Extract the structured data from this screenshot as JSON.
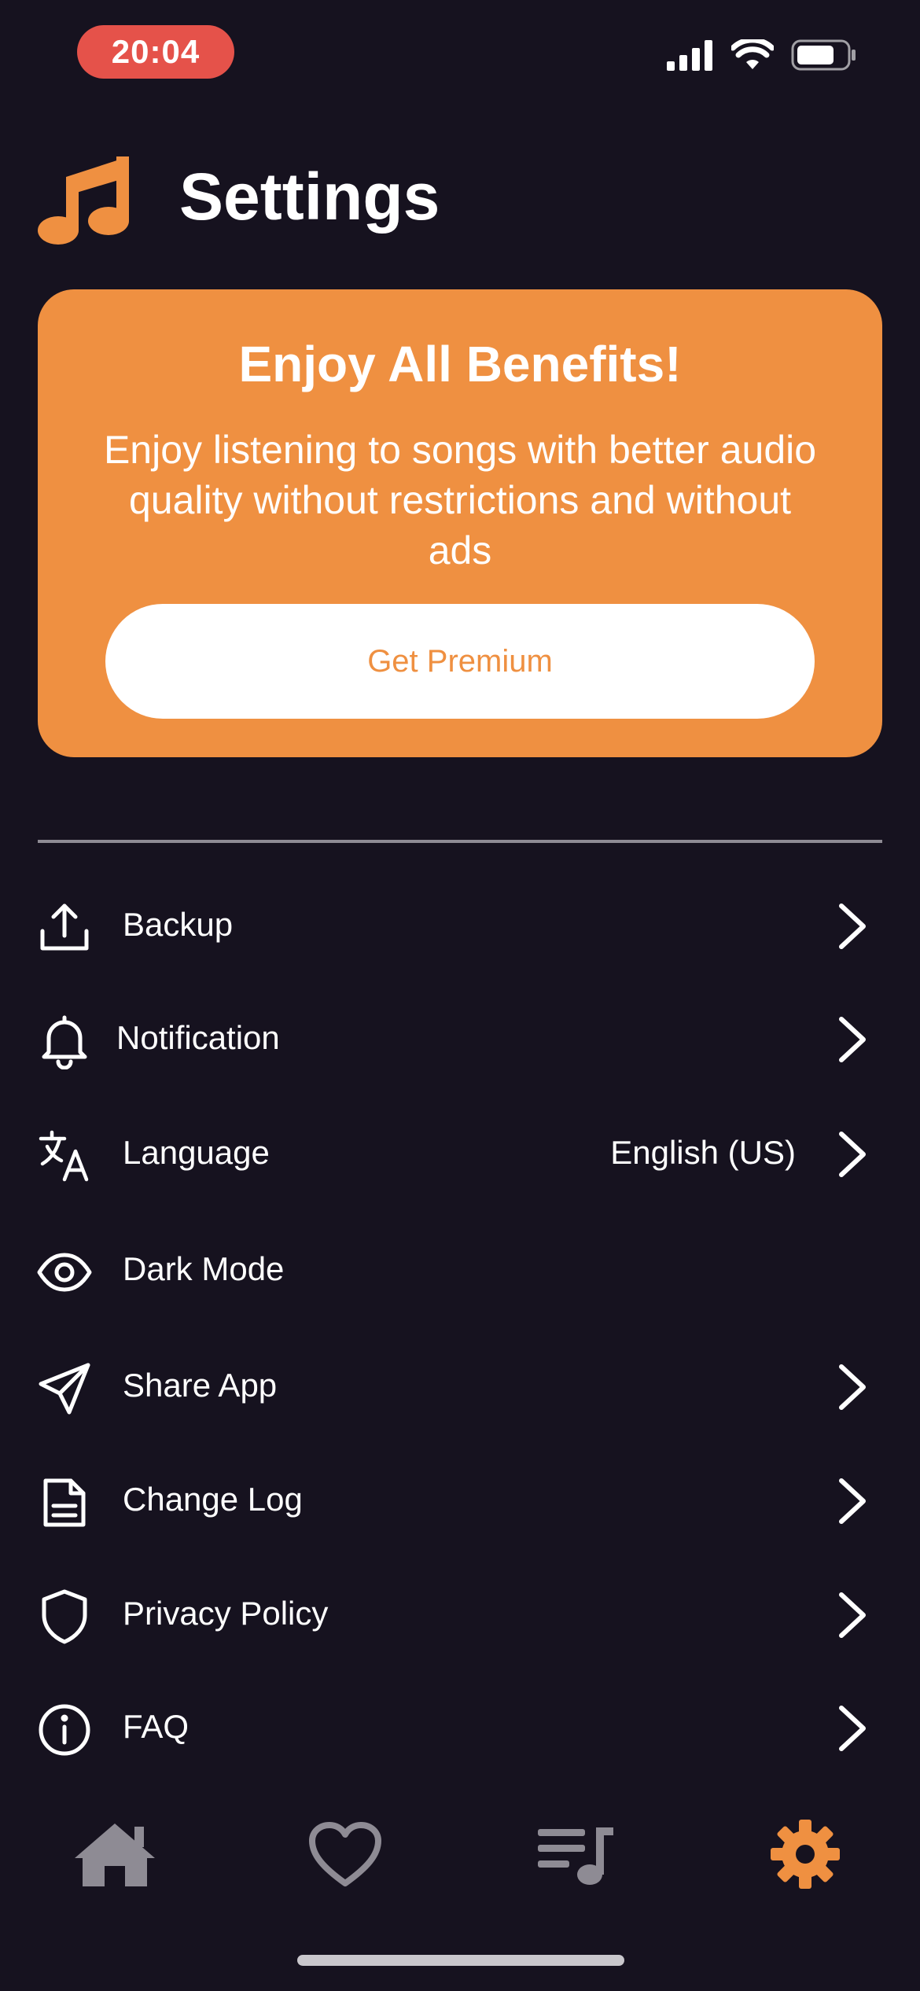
{
  "status_bar": {
    "time": "20:04"
  },
  "colors": {
    "background": "#16121f",
    "accent": "#ef9041",
    "time_pill": "#e5524a",
    "inactive_tab": "#8e8b94"
  },
  "header": {
    "logo_icon": "music-note-icon",
    "title": "Settings"
  },
  "promo": {
    "title": "Enjoy All Benefits!",
    "description": "Enjoy listening to songs with better audio quality without restrictions and without ads",
    "button_label": "Get Premium"
  },
  "settings": {
    "items": [
      {
        "label": "Backup",
        "icon": "upload-icon",
        "value": "",
        "chevron": true
      },
      {
        "label": "Notification",
        "icon": "bell-icon",
        "value": "",
        "chevron": true
      },
      {
        "label": "Language",
        "icon": "translate-icon",
        "value": "English (US)",
        "chevron": true
      },
      {
        "label": "Dark Mode",
        "icon": "eye-icon",
        "value": "",
        "chevron": false
      },
      {
        "label": "Share App",
        "icon": "send-icon",
        "value": "",
        "chevron": true
      },
      {
        "label": "Change Log",
        "icon": "document-icon",
        "value": "",
        "chevron": true
      },
      {
        "label": "Privacy Policy",
        "icon": "shield-icon",
        "value": "",
        "chevron": true
      },
      {
        "label": "FAQ",
        "icon": "info-icon",
        "value": "",
        "chevron": true
      }
    ]
  },
  "tab_bar": {
    "tabs": [
      {
        "icon": "home-icon",
        "active": false
      },
      {
        "icon": "heart-icon",
        "active": false
      },
      {
        "icon": "playlist-icon",
        "active": false
      },
      {
        "icon": "gear-icon",
        "active": true
      }
    ]
  }
}
